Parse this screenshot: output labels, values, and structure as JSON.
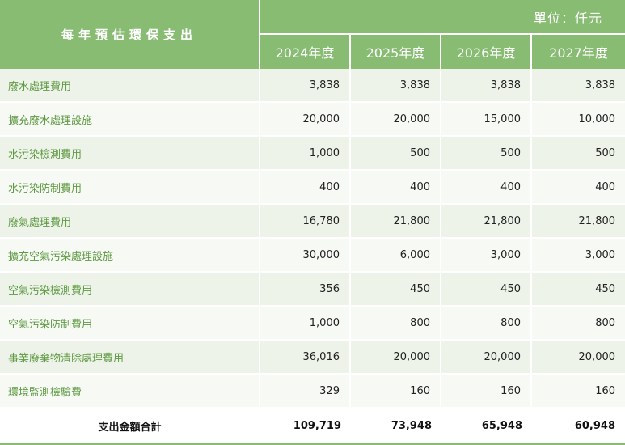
{
  "header": {
    "title": "每年預估環保支出",
    "unit": "單位：仟元",
    "years": [
      "2024年度",
      "2025年度",
      "2026年度",
      "2027年度"
    ]
  },
  "rows": [
    {
      "label": "廢水處理費用",
      "values": [
        "3,838",
        "3,838",
        "3,838",
        "3,838"
      ]
    },
    {
      "label": "擴充廢水處理設施",
      "values": [
        "20,000",
        "20,000",
        "15,000",
        "10,000"
      ]
    },
    {
      "label": "水污染檢測費用",
      "values": [
        "1,000",
        "500",
        "500",
        "500"
      ]
    },
    {
      "label": "水污染防制費用",
      "values": [
        "400",
        "400",
        "400",
        "400"
      ]
    },
    {
      "label": "廢氣處理費用",
      "values": [
        "16,780",
        "21,800",
        "21,800",
        "21,800"
      ]
    },
    {
      "label": "擴充空氣污染處理設施",
      "values": [
        "30,000",
        "6,000",
        "3,000",
        "3,000"
      ]
    },
    {
      "label": "空氣污染檢測費用",
      "values": [
        "356",
        "450",
        "450",
        "450"
      ]
    },
    {
      "label": "空氣污染防制費用",
      "values": [
        "1,000",
        "800",
        "800",
        "800"
      ]
    },
    {
      "label": "事業廢棄物清除處理費用",
      "values": [
        "36,016",
        "20,000",
        "20,000",
        "20,000"
      ]
    },
    {
      "label": "環境監測檢驗費",
      "values": [
        "329",
        "160",
        "160",
        "160"
      ]
    }
  ],
  "total": {
    "label": "支出金額合計",
    "values": [
      "109,719",
      "73,948",
      "65,948",
      "60,948"
    ]
  },
  "colors": {
    "header_green": "#87bc72",
    "label_green": "#5f9a44",
    "row_tint_a": "#edf3e8",
    "row_tint_b": "#f7f9f4"
  }
}
